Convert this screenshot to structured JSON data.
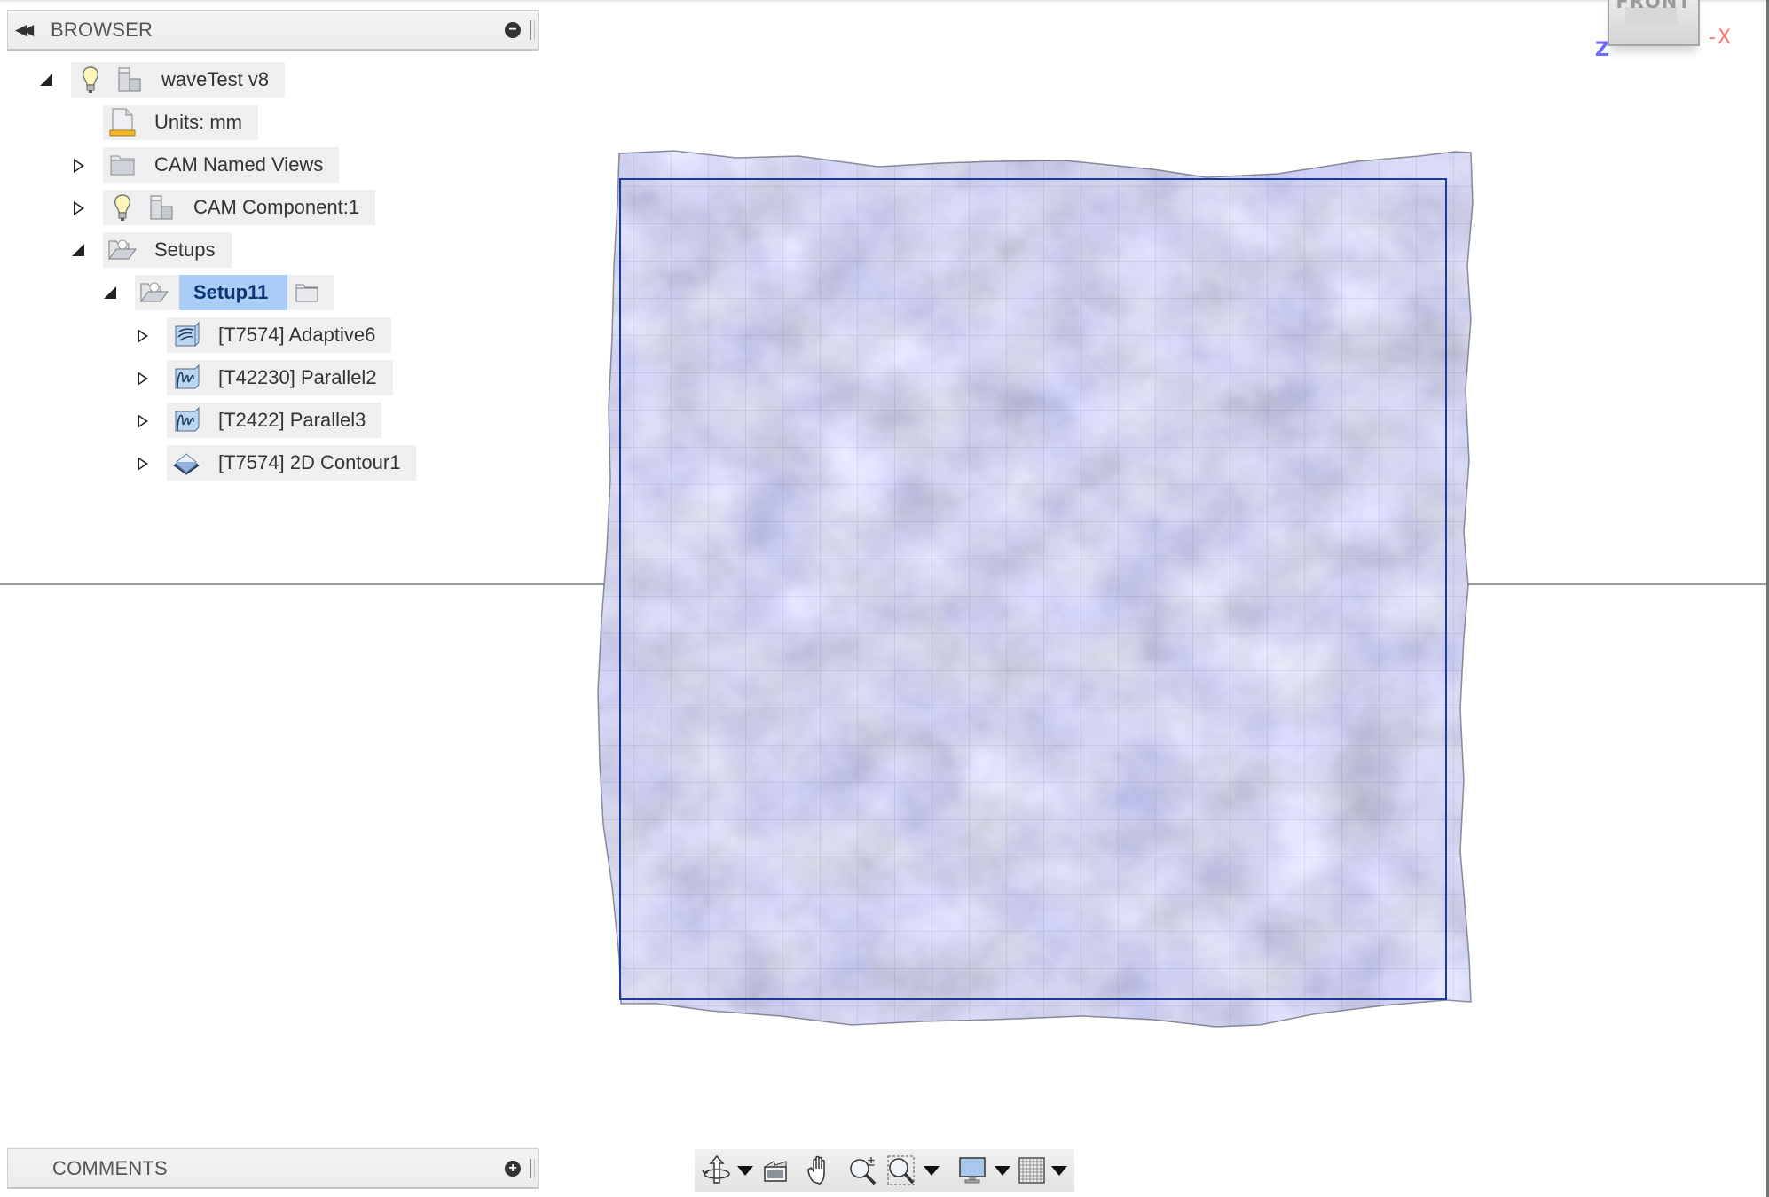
{
  "browser": {
    "title": "BROWSER",
    "collapse_icon": "double-left-arrow-icon",
    "minimize_icon": "minus-circle-icon",
    "tree": [
      {
        "label": "waveTest v8",
        "expanded": true,
        "icons": [
          "lightbulb-icon",
          "component-icon"
        ]
      },
      {
        "label": "Units: mm",
        "icons": [
          "units-document-icon"
        ]
      },
      {
        "label": "CAM Named Views",
        "expanded": false,
        "icons": [
          "folder-icon"
        ]
      },
      {
        "label": "CAM Component:1",
        "expanded": false,
        "icons": [
          "lightbulb-icon",
          "component-icon"
        ]
      },
      {
        "label": "Setups",
        "expanded": true,
        "icons": [
          "setups-folder-icon"
        ]
      },
      {
        "label": "Setup11",
        "expanded": true,
        "selected": true,
        "icons": [
          "setup-icon",
          "folder-icon"
        ]
      },
      {
        "label": "[T7574] Adaptive6",
        "expanded": false,
        "icons": [
          "adaptive-toolpath-icon"
        ]
      },
      {
        "label": "[T42230] Parallel2",
        "expanded": false,
        "icons": [
          "parallel-toolpath-icon"
        ]
      },
      {
        "label": "[T2422] Parallel3",
        "expanded": false,
        "icons": [
          "parallel-toolpath-icon"
        ]
      },
      {
        "label": "[T7574] 2D Contour1",
        "expanded": false,
        "icons": [
          "contour-toolpath-icon"
        ]
      }
    ]
  },
  "comments": {
    "title": "COMMENTS",
    "add_icon": "plus-circle-icon"
  },
  "viewcube": {
    "face": "FRONT",
    "axis_z": "Z",
    "axis_x": "X"
  },
  "toolbar": {
    "items": [
      {
        "name": "orbit",
        "icon": "orbit-icon",
        "has_dropdown": true
      },
      {
        "name": "look-at",
        "icon": "look-at-icon",
        "has_dropdown": false
      },
      {
        "name": "pan",
        "icon": "hand-icon",
        "has_dropdown": false
      },
      {
        "name": "zoom",
        "icon": "zoom-plus-icon",
        "has_dropdown": false
      },
      {
        "name": "fit-window",
        "icon": "zoom-window-icon",
        "has_dropdown": true
      },
      {
        "name": "display-settings",
        "icon": "monitor-icon",
        "has_dropdown": true
      },
      {
        "name": "grid-snaps",
        "icon": "grid-icon",
        "has_dropdown": true
      }
    ]
  },
  "colors": {
    "selection_bg": "#a9cdf6",
    "selection_text": "#0c3578",
    "stock_outline": "#1a3aa0",
    "mesh_base": "#6f7396"
  }
}
